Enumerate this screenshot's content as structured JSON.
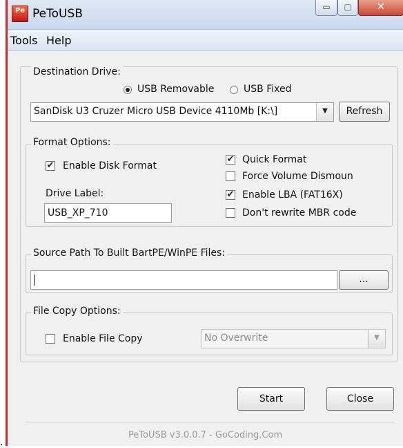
{
  "window": {
    "title": "PeToUSB",
    "app_icon_text": "Pe",
    "controls": {
      "minimize": "▭",
      "maximize": "▢",
      "close": "✕"
    }
  },
  "menu": {
    "items": [
      "Tools",
      "Help"
    ]
  },
  "destination": {
    "group_label": "Destination Drive:",
    "usb_removable_label": "USB Removable",
    "usb_fixed_label": "USB Fixed",
    "selected_type": "USB Removable",
    "drive_value": "SanDisk U3 Cruzer Micro USB Device 4110Mb [K:\\]",
    "refresh_label": "Refresh"
  },
  "format": {
    "group_label": "Format Options:",
    "enable_disk_format_label": "Enable Disk Format",
    "enable_disk_format_checked": true,
    "drive_label_caption": "Drive Label:",
    "drive_label_value": "USB_XP_710",
    "quick_format_label": "Quick Format",
    "quick_format_checked": true,
    "force_dismount_label": "Force Volume Dismoun",
    "force_dismount_checked": false,
    "enable_lba_label": "Enable LBA (FAT16X)",
    "enable_lba_checked": true,
    "dont_rewrite_mbr_label": "Don't rewrite MBR code",
    "dont_rewrite_mbr_checked": false
  },
  "source": {
    "group_label": "Source Path To Built BartPE/WinPE Files:",
    "path_value": "",
    "browse_label": "..."
  },
  "file_copy": {
    "group_label": "File Copy Options:",
    "enable_file_copy_label": "Enable File Copy",
    "enable_file_copy_checked": false,
    "overwrite_value": "No Overwrite"
  },
  "actions": {
    "start_label": "Start",
    "close_label": "Close"
  },
  "footer": {
    "text": "PeToUSB v3.0.0.7 - GoCoding.Com"
  },
  "marker": "."
}
